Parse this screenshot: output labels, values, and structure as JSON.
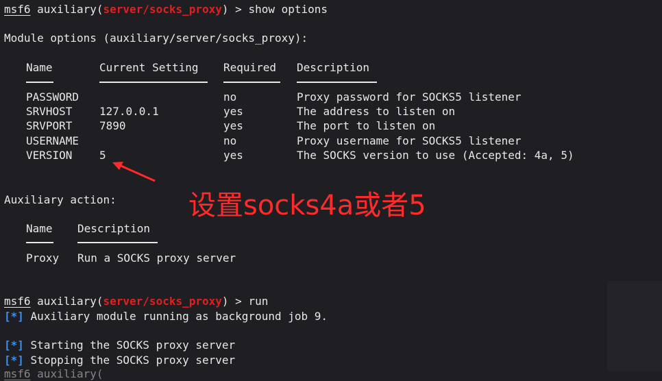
{
  "prompt": {
    "user": "msf6",
    "word": "auxiliary(",
    "module": "server/socks_proxy",
    "close": ")",
    "gt": ">"
  },
  "cmd1": "show options",
  "module_options_header": "Module options (auxiliary/server/socks_proxy):",
  "options_table": {
    "headers": [
      "Name",
      "Current Setting",
      "Required",
      "Description"
    ],
    "rows": [
      [
        "PASSWORD",
        "",
        "no",
        "Proxy password for SOCKS5 listener"
      ],
      [
        "SRVHOST",
        "127.0.0.1",
        "yes",
        "The address to listen on"
      ],
      [
        "SRVPORT",
        "7890",
        "yes",
        "The port to listen on"
      ],
      [
        "USERNAME",
        "",
        "no",
        "Proxy username for SOCKS5 listener"
      ],
      [
        "VERSION",
        "5",
        "yes",
        "The SOCKS version to use (Accepted: 4a, 5)"
      ]
    ]
  },
  "aux_action_header": "Auxiliary action:",
  "action_table": {
    "headers": [
      "Name",
      "Description"
    ],
    "rows": [
      [
        "Proxy",
        "Run a SOCKS proxy server"
      ]
    ]
  },
  "cmd2": "run",
  "status_marker": "[*]",
  "output": [
    "Auxiliary module running as background job 9.",
    "Starting the SOCKS proxy server",
    "Stopping the SOCKS proxy server"
  ],
  "annotation": "设置socks4a或者5",
  "colors": {
    "background": "#1f1f23",
    "text": "#e8e8e8",
    "module": "#e02020",
    "status": "#3b8eea",
    "annotation": "#ff2a2a"
  }
}
